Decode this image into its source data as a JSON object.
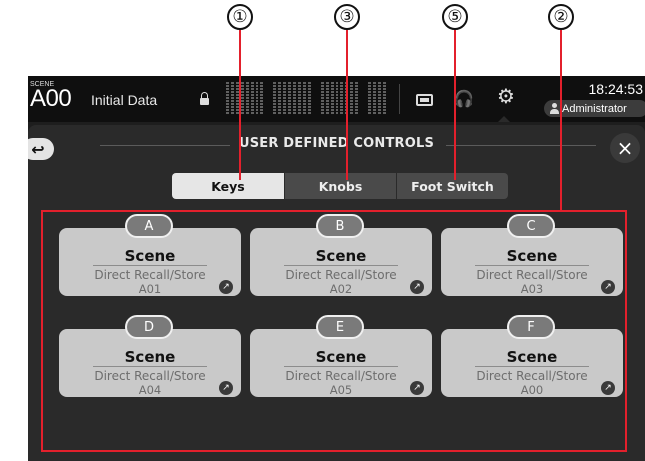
{
  "callouts": [
    "①",
    "③",
    "⑤",
    "②"
  ],
  "topbar": {
    "scene_label": "SCENE",
    "scene_number": "A00",
    "scene_name": "Initial Data",
    "time": "18:24:53",
    "user": "Administrator"
  },
  "panel": {
    "title": "USER DEFINED CONTROLS",
    "back_symbol": "↩",
    "close_symbol": "×"
  },
  "tabs": [
    {
      "label": "Keys",
      "selected": true
    },
    {
      "label": "Knobs",
      "selected": false
    },
    {
      "label": "Foot Switch",
      "selected": false
    }
  ],
  "keys": [
    {
      "letter": "A",
      "function": "Scene",
      "parameter": "Direct Recall/Store",
      "value": "A01"
    },
    {
      "letter": "B",
      "function": "Scene",
      "parameter": "Direct Recall/Store",
      "value": "A02"
    },
    {
      "letter": "C",
      "function": "Scene",
      "parameter": "Direct Recall/Store",
      "value": "A03"
    },
    {
      "letter": "D",
      "function": "Scene",
      "parameter": "Direct Recall/Store",
      "value": "A04"
    },
    {
      "letter": "E",
      "function": "Scene",
      "parameter": "Direct Recall/Store",
      "value": "A05"
    },
    {
      "letter": "F",
      "function": "Scene",
      "parameter": "Direct Recall/Store",
      "value": "A00"
    }
  ],
  "colors": {
    "callout_line": "#e3202c",
    "selected_tab": "#e6e6e6",
    "key_card": "#c9c9c9"
  }
}
